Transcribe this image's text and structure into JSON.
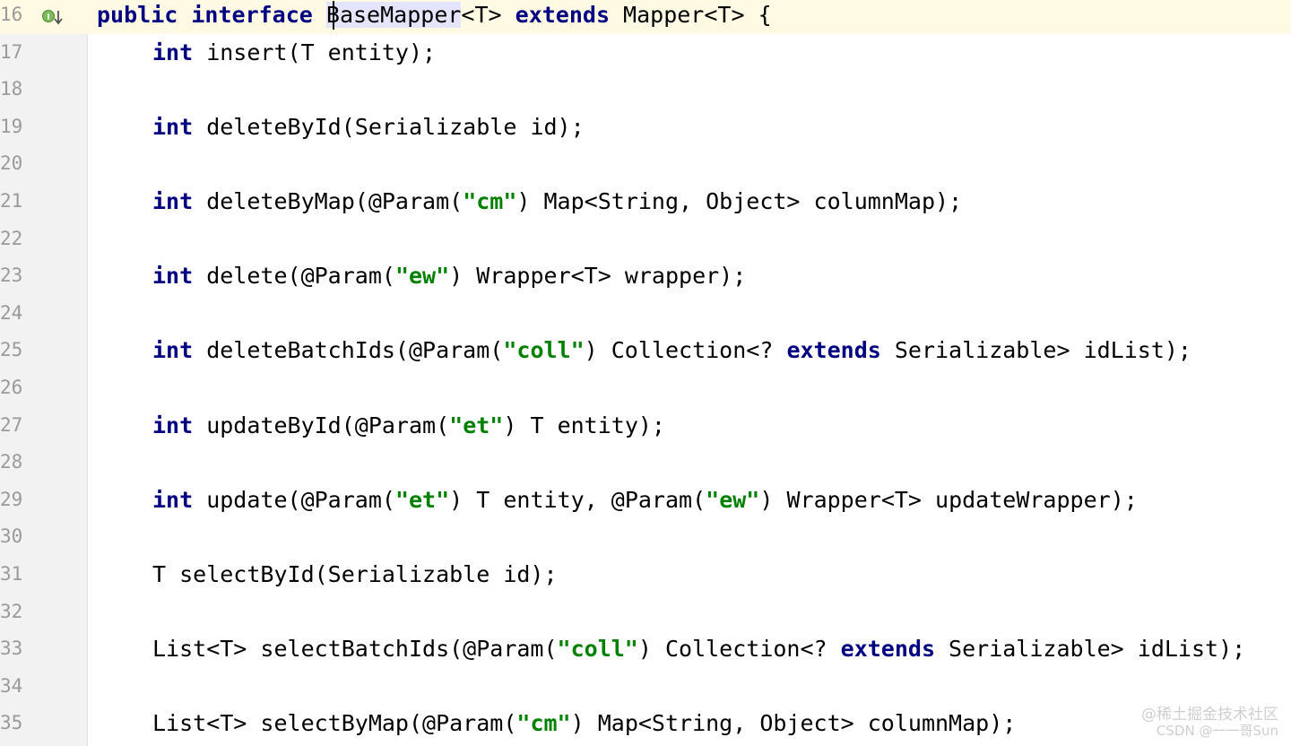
{
  "editor": {
    "lines": [
      {
        "number": "16",
        "current": true,
        "indent": 0,
        "gutter_icon": "implemented-interface-icon",
        "tokens": [
          {
            "t": "public",
            "k": "kw"
          },
          {
            "t": " ",
            "k": "plain"
          },
          {
            "t": "interface",
            "k": "kw"
          },
          {
            "t": " ",
            "k": "plain"
          },
          {
            "t": "BaseMapper",
            "k": "hl"
          },
          {
            "t": "<T> ",
            "k": "plain"
          },
          {
            "t": "extends",
            "k": "kw"
          },
          {
            "t": " Mapper<T> {",
            "k": "plain"
          }
        ]
      },
      {
        "number": "17",
        "indent": 1,
        "tokens": [
          {
            "t": "int",
            "k": "kw"
          },
          {
            "t": " insert(T entity);",
            "k": "plain"
          }
        ]
      },
      {
        "number": "18",
        "indent": 1,
        "tokens": []
      },
      {
        "number": "19",
        "indent": 1,
        "tokens": [
          {
            "t": "int",
            "k": "kw"
          },
          {
            "t": " deleteById(Serializable id);",
            "k": "plain"
          }
        ]
      },
      {
        "number": "20",
        "indent": 1,
        "tokens": []
      },
      {
        "number": "21",
        "indent": 1,
        "tokens": [
          {
            "t": "int",
            "k": "kw"
          },
          {
            "t": " deleteByMap(@Param(",
            "k": "plain"
          },
          {
            "t": "\"cm\"",
            "k": "str"
          },
          {
            "t": ") Map<String, Object> columnMap);",
            "k": "plain"
          }
        ]
      },
      {
        "number": "22",
        "indent": 1,
        "tokens": []
      },
      {
        "number": "23",
        "indent": 1,
        "tokens": [
          {
            "t": "int",
            "k": "kw"
          },
          {
            "t": " delete(@Param(",
            "k": "plain"
          },
          {
            "t": "\"ew\"",
            "k": "str"
          },
          {
            "t": ") Wrapper<T> wrapper);",
            "k": "plain"
          }
        ]
      },
      {
        "number": "24",
        "indent": 1,
        "tokens": []
      },
      {
        "number": "25",
        "indent": 1,
        "tokens": [
          {
            "t": "int",
            "k": "kw"
          },
          {
            "t": " deleteBatchIds(@Param(",
            "k": "plain"
          },
          {
            "t": "\"coll\"",
            "k": "str"
          },
          {
            "t": ") Collection<? ",
            "k": "plain"
          },
          {
            "t": "extends",
            "k": "kw"
          },
          {
            "t": " Serializable> idList);",
            "k": "plain"
          }
        ]
      },
      {
        "number": "26",
        "indent": 1,
        "tokens": []
      },
      {
        "number": "27",
        "indent": 1,
        "tokens": [
          {
            "t": "int",
            "k": "kw"
          },
          {
            "t": " updateById(@Param(",
            "k": "plain"
          },
          {
            "t": "\"et\"",
            "k": "str"
          },
          {
            "t": ") T entity);",
            "k": "plain"
          }
        ]
      },
      {
        "number": "28",
        "indent": 1,
        "tokens": []
      },
      {
        "number": "29",
        "indent": 1,
        "tokens": [
          {
            "t": "int",
            "k": "kw"
          },
          {
            "t": " update(@Param(",
            "k": "plain"
          },
          {
            "t": "\"et\"",
            "k": "str"
          },
          {
            "t": ") T entity, @Param(",
            "k": "plain"
          },
          {
            "t": "\"ew\"",
            "k": "str"
          },
          {
            "t": ") Wrapper<T> updateWrapper);",
            "k": "plain"
          }
        ]
      },
      {
        "number": "30",
        "indent": 1,
        "tokens": []
      },
      {
        "number": "31",
        "indent": 1,
        "tokens": [
          {
            "t": "T selectById(Serializable id);",
            "k": "plain"
          }
        ]
      },
      {
        "number": "32",
        "indent": 1,
        "tokens": []
      },
      {
        "number": "33",
        "indent": 1,
        "tokens": [
          {
            "t": "List<T> selectBatchIds(@Param(",
            "k": "plain"
          },
          {
            "t": "\"coll\"",
            "k": "str"
          },
          {
            "t": ") Collection<? ",
            "k": "plain"
          },
          {
            "t": "extends",
            "k": "kw"
          },
          {
            "t": " Serializable> idList);",
            "k": "plain"
          }
        ]
      },
      {
        "number": "34",
        "indent": 1,
        "tokens": []
      },
      {
        "number": "35",
        "indent": 1,
        "tokens": [
          {
            "t": "List<T> selectByMap(@Param(",
            "k": "plain"
          },
          {
            "t": "\"cm\"",
            "k": "str"
          },
          {
            "t": ") Map<String, Object> columnMap);",
            "k": "plain"
          }
        ]
      }
    ]
  },
  "watermark": {
    "line1": "@稀土掘金技术社区",
    "line2": "CSDN @一一哥Sun"
  },
  "colors": {
    "keyword": "#000080",
    "string": "#008000",
    "current_line": "#fffae3",
    "gutter": "#f2f2f2",
    "line_number": "#9a9a9a"
  }
}
